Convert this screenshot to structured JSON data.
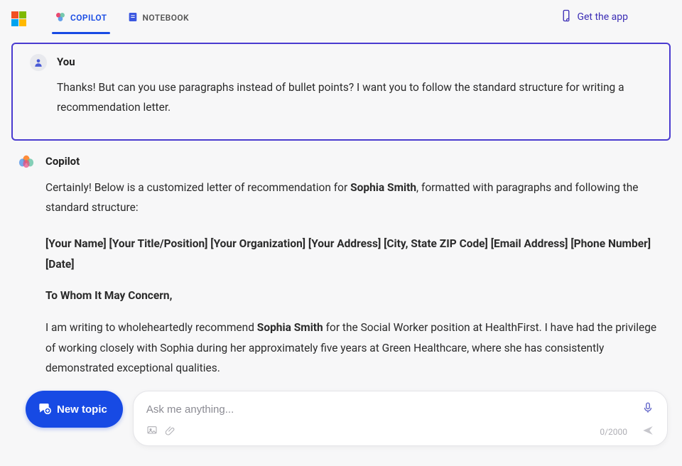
{
  "header": {
    "tabs": {
      "copilot": "COPILOT",
      "notebook": "NOTEBOOK"
    },
    "get_app": "Get the app"
  },
  "conversation": {
    "user": {
      "name": "You",
      "text": "Thanks! But can you use paragraphs instead of bullet points? I want you to follow the standard structure for writing a recommendation letter."
    },
    "assistant": {
      "name": "Copilot",
      "intro_a": "Certainly! Below is a customized letter of recommendation for ",
      "intro_bold": "Sophia Smith",
      "intro_b": ", formatted with paragraphs and following the standard structure:",
      "header_line": "[Your Name] [Your Title/Position] [Your Organization] [Your Address] [City, State ZIP Code] [Email Address] [Phone Number] [Date]",
      "salutation": "To Whom It May Concern,",
      "body1_a": "I am writing to wholeheartedly recommend ",
      "body1_bold": "Sophia Smith",
      "body1_b": " for the Social Worker position at HealthFirst. I have had the privilege of working closely with Sophia during her approximately five years at Green Healthcare, where she has consistently demonstrated exceptional qualities."
    }
  },
  "input": {
    "new_topic": "New topic",
    "placeholder": "Ask me anything...",
    "counter": "0/2000"
  }
}
